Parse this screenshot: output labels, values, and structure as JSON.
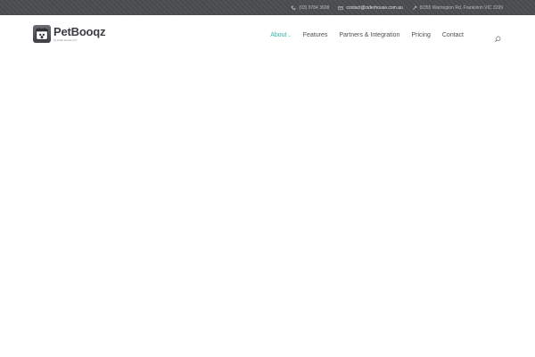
{
  "topbar": {
    "phone": "(03) 9784 3608",
    "email": "contact@ciderhouse.com.au",
    "address": "8/355 Warrington Rd, Frankston VIC 3199",
    "phone_icon": "phone-icon",
    "email_icon": "mail-icon",
    "address_icon": "pin-icon"
  },
  "logo": {
    "name": "PetBooqz",
    "tagline": "by Cider House ICT"
  },
  "nav": {
    "items": [
      {
        "label": "About",
        "active": true,
        "has_dropdown": true
      },
      {
        "label": "Features"
      },
      {
        "label": "Partners & Integration"
      },
      {
        "label": "Pricing"
      },
      {
        "label": "Contact"
      }
    ],
    "dropdown_glyph": "⌄"
  },
  "colors": {
    "topbar_bg": "#4a4c50",
    "accent": "#2fb7a8",
    "nav_text": "#4b4f55"
  }
}
